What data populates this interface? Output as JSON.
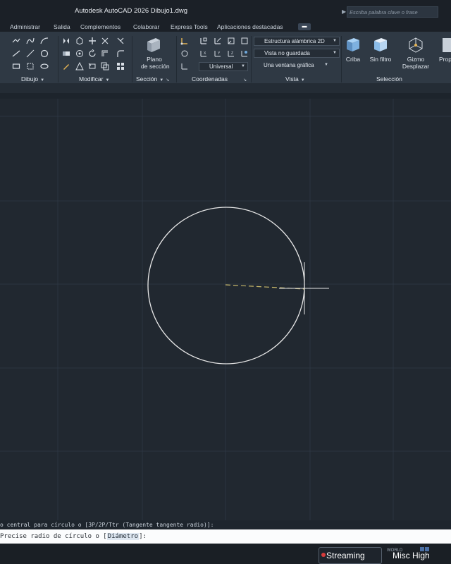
{
  "titlebar": {
    "title": "Autodesk AutoCAD 2026    Dibujo1.dwg",
    "search_placeholder": "Escriba palabra clave o frase"
  },
  "tabs": [
    "Administrar",
    "Salida",
    "Complementos",
    "Colaborar",
    "Express Tools",
    "Aplicaciones destacadas"
  ],
  "ribbon": {
    "groups": {
      "dibujo": "Dibujo",
      "modificar": "Modificar",
      "seccion": "Sección",
      "coordenadas": "Coordenadas",
      "vista": "Vista",
      "seleccion": "Selección"
    },
    "buttons": {
      "plano_line1": "Plano",
      "plano_line2": "de sección",
      "criba": "Criba",
      "sin_filtro": "Sin filtro",
      "gizmo_line1": "Gizmo",
      "gizmo_line2": "Desplazar",
      "propiedades_partial": "Prop"
    },
    "combos": {
      "visual_style": "Estructura alámbrica 2D",
      "view": "Vista no guardada",
      "ucs": "Universal",
      "viewport": "Una ventana gráfica"
    }
  },
  "command_line": {
    "history": "o central para círculo o [3P/2P/Ttr (Tangente tangente radio)]:",
    "prompt_before": "Precise radio de círculo o [",
    "prompt_option": "Diámetro",
    "prompt_after": "]:"
  },
  "status_bar": {
    "streaming_label": "Streaming",
    "misc_label": "Misc High",
    "tiny_label": "WORLD"
  },
  "colors": {
    "background": "#212830",
    "ribbon": "#2f3944",
    "circle": "#e8e8e8",
    "rubberband": "#c8b86a",
    "command_line_bg": "#fbfcfd"
  },
  "icons": [
    "line-icon",
    "polyline-icon",
    "circle-icon",
    "arc-icon",
    "move-icon",
    "rotate-icon",
    "trim-icon",
    "copy-icon",
    "mirror-icon",
    "fillet-icon",
    "stretch-icon",
    "scale-icon",
    "array-icon",
    "section-plane-icon",
    "ucs-icon",
    "view-cube-icon",
    "gizmo-icon",
    "crosshair-icon"
  ]
}
